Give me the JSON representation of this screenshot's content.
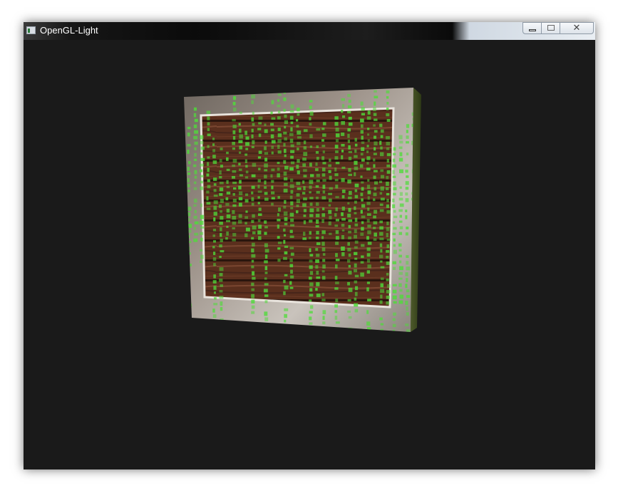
{
  "window": {
    "title": "OpenGL-Light",
    "background_color": "#1a1a1a",
    "controls": {
      "minimize_icon": "minimize-icon",
      "maximize_icon": "maximize-icon",
      "close_icon": "close-icon"
    }
  },
  "scene": {
    "object": "textured-crate",
    "overlay": "green-matrix-glyph-texture",
    "overlay_color": "#4fdc3a"
  }
}
